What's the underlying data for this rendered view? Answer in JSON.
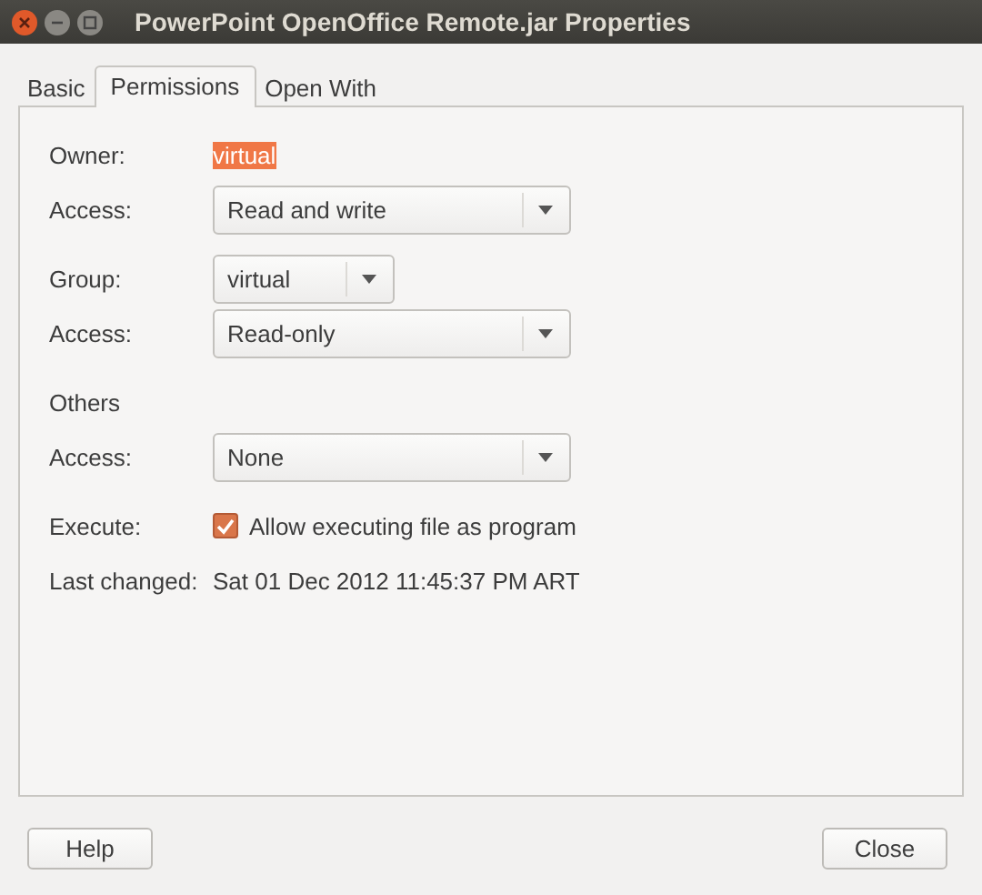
{
  "window": {
    "title": "PowerPoint OpenOffice Remote.jar Properties"
  },
  "tabs": [
    {
      "label": "Basic",
      "selected": false
    },
    {
      "label": "Permissions",
      "selected": true
    },
    {
      "label": "Open With",
      "selected": false
    }
  ],
  "sections": [
    {
      "rows": [
        {
          "kind": "text",
          "label": "Owner:",
          "value": "virtual",
          "highlighted": true
        },
        {
          "kind": "dropdown",
          "label": "Access:",
          "value": "Read and write",
          "wide": true
        }
      ]
    },
    {
      "rows": [
        {
          "kind": "dropdown",
          "label": "Group:",
          "value": "virtual",
          "wide": false
        },
        {
          "kind": "dropdown",
          "label": "Access:",
          "value": "Read-only",
          "wide": true
        }
      ]
    },
    {
      "rows": [
        {
          "kind": "heading",
          "label": "Others"
        },
        {
          "kind": "dropdown",
          "label": "Access:",
          "value": "None",
          "wide": true
        }
      ]
    },
    {
      "rows": [
        {
          "kind": "checkbox",
          "label": "Execute:",
          "value": "Allow executing file as program",
          "checked": true
        },
        {
          "kind": "text",
          "label": "Last changed:",
          "value": "Sat 01 Dec 2012 11:45:37 PM ART",
          "highlighted": false
        }
      ]
    }
  ],
  "buttons": [
    "Help",
    "Close"
  ]
}
